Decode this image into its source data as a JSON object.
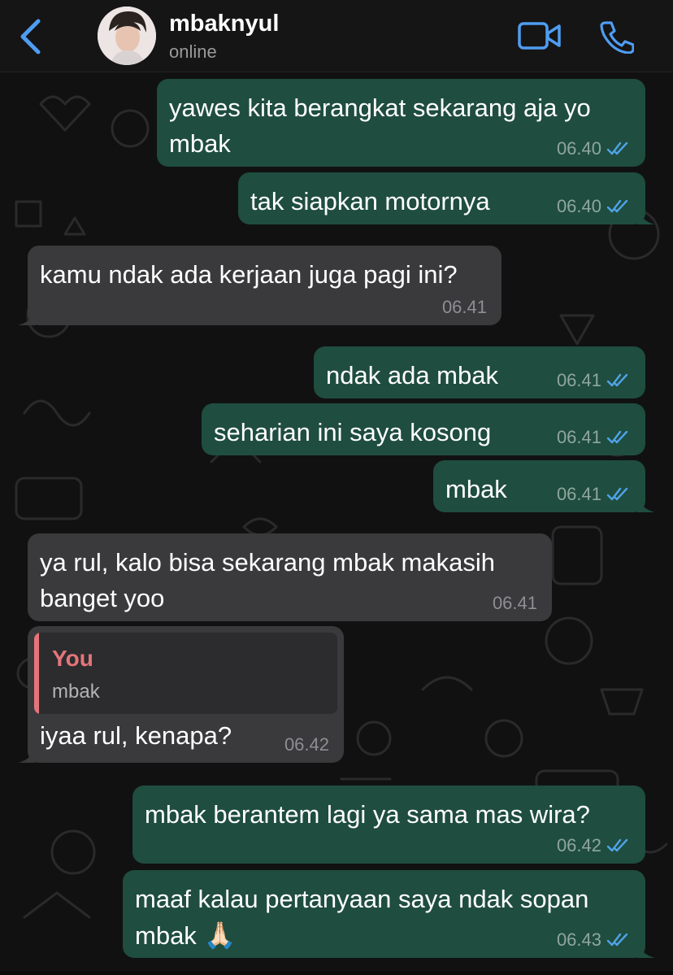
{
  "header": {
    "contact_name": "mbaknyul",
    "status": "online",
    "back_icon": "chevron-left-icon",
    "video_icon": "video-camera-icon",
    "call_icon": "phone-icon"
  },
  "colors": {
    "accent": "#4f9df2",
    "outgoing_bubble": "#1f4d3f",
    "incoming_bubble": "#3a3a3c",
    "reply_author": "#e5757a",
    "read_ticks": "#4fa3e8"
  },
  "messages": [
    {
      "direction": "out",
      "text": "yawes kita berangkat sekarang aja yo mbak",
      "time": "06.40",
      "read": true
    },
    {
      "direction": "out",
      "text": "tak siapkan motornya",
      "time": "06.40",
      "read": true
    },
    {
      "direction": "in",
      "text": "kamu ndak ada kerjaan juga pagi ini?",
      "time": "06.41"
    },
    {
      "direction": "out",
      "text": "ndak ada mbak",
      "time": "06.41",
      "read": true
    },
    {
      "direction": "out",
      "text": "seharian ini saya kosong",
      "time": "06.41",
      "read": true
    },
    {
      "direction": "out",
      "text": "mbak",
      "time": "06.41",
      "read": true
    },
    {
      "direction": "in",
      "text": "ya rul, kalo bisa sekarang mbak makasih banget yoo",
      "time": "06.41"
    },
    {
      "direction": "in",
      "text": "iyaa rul, kenapa?",
      "time": "06.42",
      "reply": {
        "author": "You",
        "text": "mbak"
      }
    },
    {
      "direction": "out",
      "text": "mbak berantem lagi ya sama mas wira?",
      "time": "06.42",
      "read": true
    },
    {
      "direction": "out",
      "text": "maaf kalau pertanyaan saya ndak sopan mbak",
      "emoji": "🙏🏻",
      "time": "06.43",
      "read": true
    }
  ]
}
